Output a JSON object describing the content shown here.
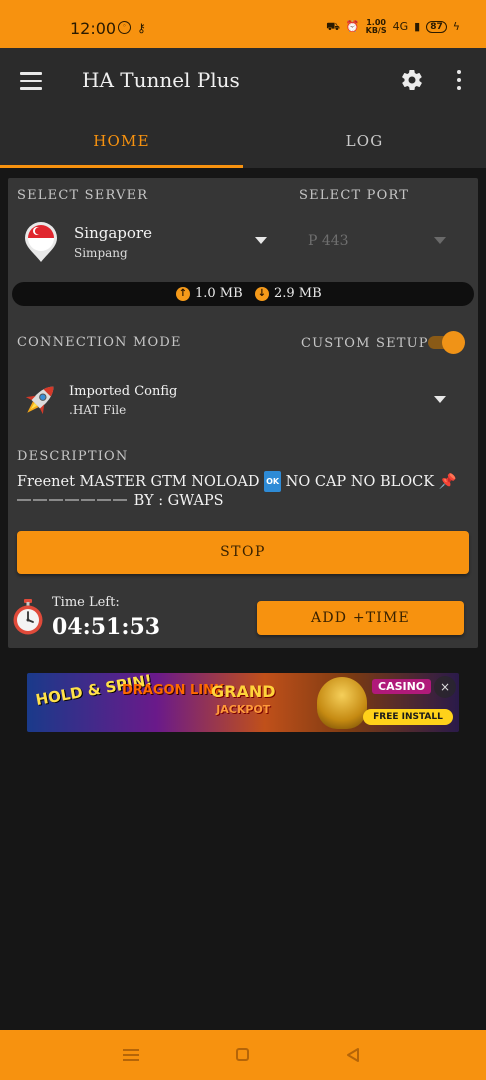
{
  "status_bar": {
    "time": "12:00",
    "speed_value": "1.00",
    "speed_unit": "KB/S",
    "network": "4G",
    "battery": "87"
  },
  "app_bar": {
    "title": "HA Tunnel Plus"
  },
  "tabs": [
    {
      "label": "HOME",
      "active": true
    },
    {
      "label": "LOG",
      "active": false
    }
  ],
  "server": {
    "section_label": "SELECT SERVER",
    "name": "Singapore",
    "location": "Simpang"
  },
  "port": {
    "section_label": "SELECT PORT",
    "value": "P 443"
  },
  "data_usage": {
    "upload": "1.0 MB",
    "download": "2.9 MB"
  },
  "connection": {
    "mode_label": "CONNECTION MODE",
    "custom_setup_label": "CUSTOM SETUP",
    "custom_setup_on": true,
    "config_name": "Imported Config",
    "config_type": ".HAT File"
  },
  "description": {
    "label": "DESCRIPTION",
    "text_part1": "Freenet MASTER GTM NOLOAD ",
    "ok_badge": "OK",
    "text_part2": " NO CAP NO BLOCK",
    "text_part3": "BY : GWAPS"
  },
  "actions": {
    "stop_label": "STOP",
    "time_left_label": "Time Left:",
    "time_left_value": "04:51:53",
    "add_time_label": "ADD +TIME"
  },
  "ad": {
    "hold_spin": "HOLD & SPIN!",
    "dragon_link": "DRAGON LINK",
    "grand": "GRAND",
    "jackpot": "JACKPOT",
    "casino": "CASINO",
    "install": "FREE INSTALL"
  },
  "colors": {
    "accent": "#f7920f",
    "background": "#161616",
    "surface": "#2b2b2b",
    "card": "#363636"
  }
}
